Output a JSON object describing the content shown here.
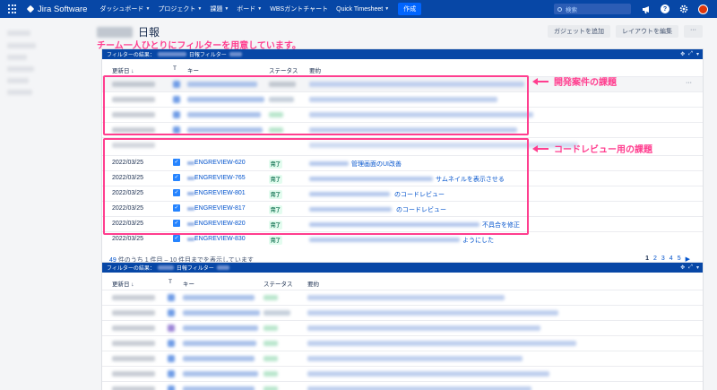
{
  "topnav": {
    "product": "Jira Software",
    "items": [
      {
        "label": "ダッシュボード",
        "chevron": true
      },
      {
        "label": "プロジェクト",
        "chevron": true
      },
      {
        "label": "課題",
        "chevron": true
      },
      {
        "label": "ボード",
        "chevron": true
      },
      {
        "label": "WBSガントチャート",
        "chevron": false
      },
      {
        "label": "Quick Timesheet",
        "chevron": true
      }
    ],
    "create_label": "作成",
    "search_placeholder": "検索"
  },
  "page": {
    "title": "日報",
    "buttons": {
      "add_gadget": "ガジェットを追加",
      "edit_layout": "レイアウトを編集",
      "more": "···"
    }
  },
  "annotations": {
    "headline": "チーム一人ひとりにフィルターを用意しています。",
    "dev_tasks": "開発案件の課題",
    "code_review": "コードレビュー用の課題"
  },
  "gadget1": {
    "title_prefix": "フィルターの結果：",
    "title_suffix": "日報フィルター",
    "columns": {
      "updated": "更新日 ↓",
      "type": "T",
      "key": "キー",
      "status": "ステータス",
      "summary": "要約"
    },
    "rows": [
      {
        "date": "2022/03/25",
        "key": "ENGREVIEW-620",
        "status": "完了",
        "summary": "管理画面のUI改善"
      },
      {
        "date": "2022/03/25",
        "key": "ENGREVIEW-765",
        "status": "完了",
        "summary": "サムネイルを表示させる"
      },
      {
        "date": "2022/03/25",
        "key": "ENGREVIEW-801",
        "status": "完了",
        "summary": "のコードレビュー"
      },
      {
        "date": "2022/03/25",
        "key": "ENGREVIEW-817",
        "status": "完了",
        "summary": "のコードレビュー"
      },
      {
        "date": "2022/03/25",
        "key": "ENGREVIEW-820",
        "status": "完了",
        "summary": "不具合を修正"
      },
      {
        "date": "2022/03/25",
        "key": "ENGREVIEW-830",
        "status": "完了",
        "summary": "ようにした"
      }
    ],
    "footer": {
      "total": "49",
      "rest": "件のうち 1 件目 – 10 件目までを表示しています"
    },
    "pages": [
      "1",
      "2",
      "3",
      "4",
      "5",
      "▶"
    ],
    "row_more": "···"
  },
  "gadget2": {
    "title_prefix": "フィルターの結果：",
    "title_suffix": "日報フィルター",
    "columns": {
      "updated": "更新日 ↓",
      "type": "T",
      "key": "キー",
      "status": "ステータス",
      "summary": "要約"
    }
  }
}
